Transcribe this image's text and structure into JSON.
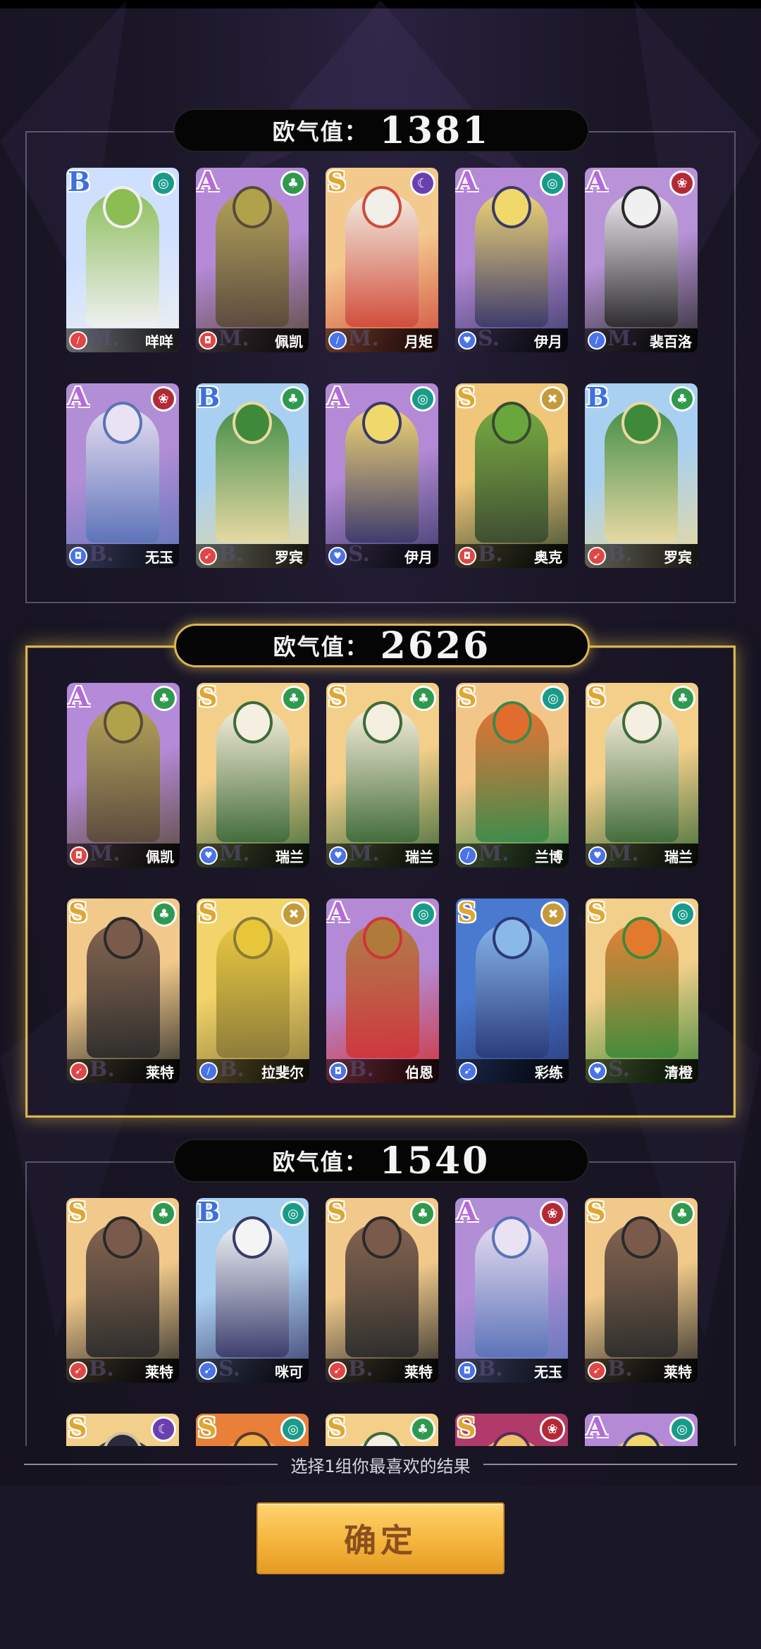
{
  "score_label": "欧气值：",
  "groups": [
    {
      "score": "1381",
      "cards": [
        {
          "rarity": "B",
          "faction": "teal",
          "faction_icon": "swirl-icon",
          "class": "red",
          "class_icon": "sword-icon",
          "grade": "M.",
          "name": "咩咩",
          "palette": [
            "#cfe0ff",
            "#8bbd52",
            "#f0f0f0"
          ]
        },
        {
          "rarity": "A",
          "faction": "green",
          "faction_icon": "leaf-icon",
          "class": "red",
          "class_icon": "shield-icon",
          "grade": "M.",
          "name": "佩凯",
          "palette": [
            "#b58ad8",
            "#b0a24a",
            "#5a4a3a"
          ]
        },
        {
          "rarity": "S",
          "faction": "purple",
          "faction_icon": "moon-icon",
          "class": "blue",
          "class_icon": "sword-icon",
          "grade": "M.",
          "name": "月矩",
          "palette": [
            "#f4c98e",
            "#f0efe8",
            "#d14a3a"
          ]
        },
        {
          "rarity": "A",
          "faction": "teal",
          "faction_icon": "swirl-icon",
          "class": "blue",
          "class_icon": "heart-icon",
          "grade": "S.",
          "name": "伊月",
          "palette": [
            "#b48ad6",
            "#f1d86a",
            "#3b3a6a"
          ]
        },
        {
          "rarity": "A",
          "faction": "red",
          "faction_icon": "flame-icon",
          "class": "blue",
          "class_icon": "sword-icon",
          "grade": "M.",
          "name": "裴百洛",
          "palette": [
            "#b893d8",
            "#f0f0f0",
            "#2a2a2a"
          ]
        },
        {
          "rarity": "A",
          "faction": "red",
          "faction_icon": "flame-icon",
          "class": "blue",
          "class_icon": "shield-icon",
          "grade": "B.",
          "name": "无玉",
          "palette": [
            "#b28ed6",
            "#e8e2f2",
            "#5a73b8"
          ]
        },
        {
          "rarity": "B",
          "faction": "green",
          "faction_icon": "leaf-icon",
          "class": "red",
          "class_icon": "bow-icon",
          "grade": "B.",
          "name": "罗宾",
          "palette": [
            "#a9d0f0",
            "#3f8a3a",
            "#e8d9a0"
          ]
        },
        {
          "rarity": "A",
          "faction": "teal",
          "faction_icon": "swirl-icon",
          "class": "blue",
          "class_icon": "heart-icon",
          "grade": "S.",
          "name": "伊月",
          "palette": [
            "#b48ad6",
            "#f1d86a",
            "#3b3a6a"
          ]
        },
        {
          "rarity": "S",
          "faction": "gold",
          "faction_icon": "cross-icon",
          "class": "red",
          "class_icon": "shield-icon",
          "grade": "B.",
          "name": "奥克",
          "palette": [
            "#f0c67a",
            "#69a63c",
            "#3a4a30"
          ]
        },
        {
          "rarity": "B",
          "faction": "green",
          "faction_icon": "leaf-icon",
          "class": "red",
          "class_icon": "bow-icon",
          "grade": "B.",
          "name": "罗宾",
          "palette": [
            "#a9d0f0",
            "#3f8a3a",
            "#e8d9a0"
          ]
        }
      ]
    },
    {
      "score": "2626",
      "cards": [
        {
          "rarity": "A",
          "faction": "green",
          "faction_icon": "leaf-icon",
          "class": "red",
          "class_icon": "shield-icon",
          "grade": "M.",
          "name": "佩凯",
          "palette": [
            "#b58ad8",
            "#b0a24a",
            "#5a4a3a"
          ]
        },
        {
          "rarity": "S",
          "faction": "green",
          "faction_icon": "leaf-icon",
          "class": "blue",
          "class_icon": "heart-icon",
          "grade": "M.",
          "name": "瑞兰",
          "palette": [
            "#f3cf8a",
            "#f4efe0",
            "#3e6a3a"
          ]
        },
        {
          "rarity": "S",
          "faction": "green",
          "faction_icon": "leaf-icon",
          "class": "blue",
          "class_icon": "heart-icon",
          "grade": "M.",
          "name": "瑞兰",
          "palette": [
            "#f3cf8a",
            "#f4efe0",
            "#3e6a3a"
          ]
        },
        {
          "rarity": "S",
          "faction": "teal",
          "faction_icon": "swirl-icon",
          "class": "blue",
          "class_icon": "sword-icon",
          "grade": "M.",
          "name": "兰博",
          "palette": [
            "#f2c688",
            "#e26b2e",
            "#3a8a4a"
          ]
        },
        {
          "rarity": "S",
          "faction": "green",
          "faction_icon": "leaf-icon",
          "class": "blue",
          "class_icon": "heart-icon",
          "grade": "M.",
          "name": "瑞兰",
          "palette": [
            "#f3cf8a",
            "#f4efe0",
            "#3e6a3a"
          ]
        },
        {
          "rarity": "S",
          "faction": "green",
          "faction_icon": "leaf-icon",
          "class": "red",
          "class_icon": "bow-icon",
          "grade": "B.",
          "name": "莱特",
          "palette": [
            "#f1c98a",
            "#7a5a4a",
            "#2a2a2a"
          ]
        },
        {
          "rarity": "S",
          "faction": "gold",
          "faction_icon": "cross-icon",
          "class": "blue",
          "class_icon": "sword-icon",
          "grade": "B.",
          "name": "拉斐尔",
          "palette": [
            "#f3d46a",
            "#e8c63a",
            "#8a7a3a"
          ]
        },
        {
          "rarity": "A",
          "faction": "teal",
          "faction_icon": "swirl-icon",
          "class": "blue",
          "class_icon": "shield-icon",
          "grade": "B.",
          "name": "伯恩",
          "palette": [
            "#b48ad6",
            "#b07a3a",
            "#d0343a"
          ]
        },
        {
          "rarity": "S",
          "faction": "gold",
          "faction_icon": "cross-icon",
          "class": "blue",
          "class_icon": "bow-icon",
          "grade": "",
          "name": "彩练",
          "palette": [
            "#4a7ad0",
            "#8ab8e8",
            "#2a3a7a"
          ]
        },
        {
          "rarity": "S",
          "faction": "teal",
          "faction_icon": "swirl-icon",
          "class": "blue",
          "class_icon": "heart-icon",
          "grade": "S.",
          "name": "清橙",
          "palette": [
            "#f2cf8a",
            "#e27a2e",
            "#3f8a3a"
          ]
        }
      ]
    },
    {
      "score": "1540",
      "cards": [
        {
          "rarity": "S",
          "faction": "green",
          "faction_icon": "leaf-icon",
          "class": "red",
          "class_icon": "bow-icon",
          "grade": "B.",
          "name": "莱特",
          "palette": [
            "#f1c98a",
            "#7a5a4a",
            "#2a2a2a"
          ]
        },
        {
          "rarity": "B",
          "faction": "teal",
          "faction_icon": "swirl-icon",
          "class": "blue",
          "class_icon": "bow-icon",
          "grade": "S.",
          "name": "咪可",
          "palette": [
            "#a9d0f0",
            "#f4f4f4",
            "#3a3a6a"
          ]
        },
        {
          "rarity": "S",
          "faction": "green",
          "faction_icon": "leaf-icon",
          "class": "red",
          "class_icon": "bow-icon",
          "grade": "B.",
          "name": "莱特",
          "palette": [
            "#f1c98a",
            "#7a5a4a",
            "#2a2a2a"
          ]
        },
        {
          "rarity": "A",
          "faction": "red",
          "faction_icon": "flame-icon",
          "class": "blue",
          "class_icon": "shield-icon",
          "grade": "B.",
          "name": "无玉",
          "palette": [
            "#b28ed6",
            "#e8e2f2",
            "#5a73b8"
          ]
        },
        {
          "rarity": "S",
          "faction": "green",
          "faction_icon": "leaf-icon",
          "class": "red",
          "class_icon": "bow-icon",
          "grade": "B.",
          "name": "莱特",
          "palette": [
            "#f1c98a",
            "#7a5a4a",
            "#2a2a2a"
          ]
        },
        {
          "rarity": "S",
          "faction": "purple",
          "faction_icon": "moon-icon",
          "class": "red",
          "class_icon": "sword-icon",
          "grade": "",
          "name": "",
          "palette": [
            "#f2cf8a",
            "#2a2a3a",
            "#d0c0a0"
          ]
        },
        {
          "rarity": "S",
          "faction": "teal",
          "faction_icon": "swirl-icon",
          "class": "red",
          "class_icon": "sword-icon",
          "grade": "",
          "name": "",
          "palette": [
            "#e8803a",
            "#f0b04a",
            "#5a3a2a"
          ]
        },
        {
          "rarity": "S",
          "faction": "green",
          "faction_icon": "leaf-icon",
          "class": "blue",
          "class_icon": "heart-icon",
          "grade": "",
          "name": "",
          "palette": [
            "#f3cf8a",
            "#f4efe0",
            "#3e6a3a"
          ]
        },
        {
          "rarity": "S",
          "faction": "red",
          "faction_icon": "flame-icon",
          "class": "blue",
          "class_icon": "heart-icon",
          "grade": "",
          "name": "",
          "palette": [
            "#b03a6a",
            "#f0c06a",
            "#5a2a5a"
          ]
        },
        {
          "rarity": "A",
          "faction": "teal",
          "faction_icon": "swirl-icon",
          "class": "blue",
          "class_icon": "heart-icon",
          "grade": "",
          "name": "",
          "palette": [
            "#b48ad6",
            "#f1d86a",
            "#3b3a6a"
          ]
        }
      ]
    }
  ],
  "selected_group": 1,
  "hint": "选择1组你最喜欢的结果",
  "confirm_label": "确定"
}
